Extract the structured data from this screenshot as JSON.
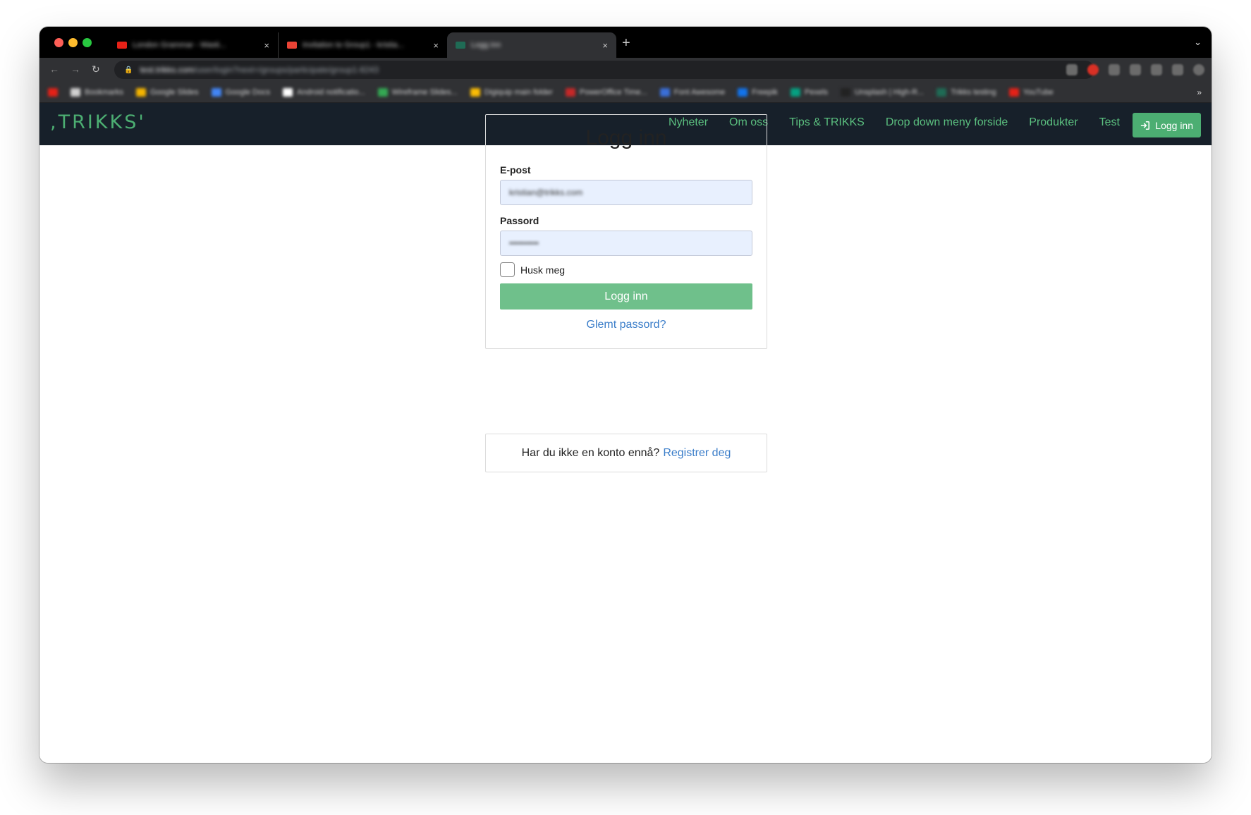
{
  "browser": {
    "tabs": [
      {
        "title": "London Grammar - Wasti...",
        "favicon_color": "#e62117"
      },
      {
        "title": "Invitation to Group1 - kristia...",
        "favicon_color": "#ea4335"
      },
      {
        "title": "Logg inn",
        "favicon_color": "#1f6b55"
      }
    ],
    "url_host": "test.trikks.com",
    "url_path": "/user/login?next=/groups/participate/group1-8243",
    "bookmarks": [
      {
        "label": "Bookmarks",
        "color": "#d0d0d0"
      },
      {
        "label": "Google Slides",
        "color": "#f4b400"
      },
      {
        "label": "Google Docs",
        "color": "#4285f4"
      },
      {
        "label": "Android notificatio...",
        "color": "#ffffff"
      },
      {
        "label": "Wireframe Slides...",
        "color": "#34a853"
      },
      {
        "label": "Digiquip main folder",
        "color": "#fbbc05"
      },
      {
        "label": "PowerOffice Time...",
        "color": "#c62828"
      },
      {
        "label": "Font Awesome",
        "color": "#3a6fd8"
      },
      {
        "label": "Freepik",
        "color": "#1273eb"
      },
      {
        "label": "Pexels",
        "color": "#05a081"
      },
      {
        "label": "Unsplash | High-R...",
        "color": "#222222"
      },
      {
        "label": "Trikks testing",
        "color": "#1f6b55"
      },
      {
        "label": "YouTube",
        "color": "#e62117"
      }
    ]
  },
  "site": {
    "logo": ",TRIKKS'",
    "nav": [
      "Nyheter",
      "Om oss",
      "Tips & TRIKKS",
      "Drop down meny forside",
      "Produkter",
      "Test"
    ],
    "login_button": "Logg inn",
    "accent": "#4cae72"
  },
  "login": {
    "title": "Logg inn",
    "email_label": "E-post",
    "email_value": "kristian@trikks.com",
    "password_label": "Passord",
    "password_value": "••••••••••",
    "remember_label": "Husk meg",
    "submit_label": "Logg inn",
    "forgot_label": "Glemt passord?"
  },
  "register": {
    "prompt": "Har du ikke en konto ennå?",
    "link": "Registrer deg"
  }
}
